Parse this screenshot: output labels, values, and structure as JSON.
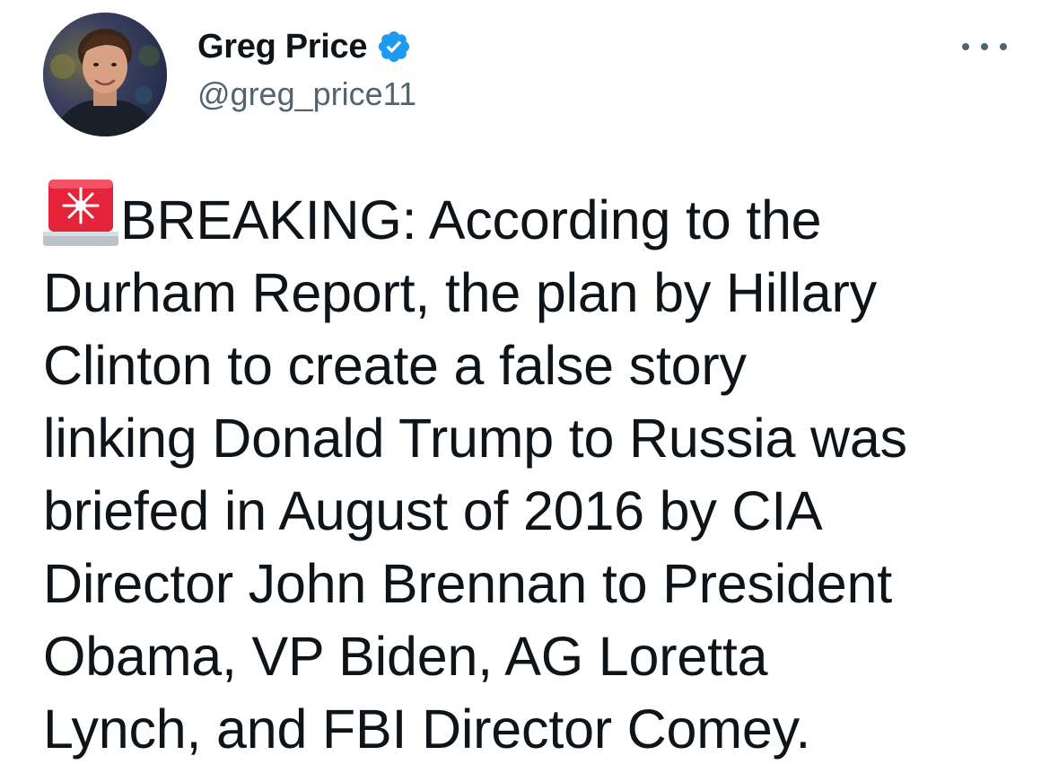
{
  "tweet": {
    "author": {
      "display_name": "Greg Price",
      "handle": "@greg_price11",
      "verified": true,
      "verified_color": "#1d9bf0"
    },
    "more_icon": "more-options-icon",
    "emoji_icon": "police-car-light-emoji",
    "text_lines": [
      "BREAKING: According to the",
      "Durham Report, the plan by Hillary",
      "Clinton to create a false story",
      "linking Donald Trump to Russia was",
      "briefed in August of 2016 by CIA",
      "Director John Brennan to President",
      "Obama, VP Biden, AG Loretta",
      "Lynch, and FBI Director Comey."
    ]
  }
}
